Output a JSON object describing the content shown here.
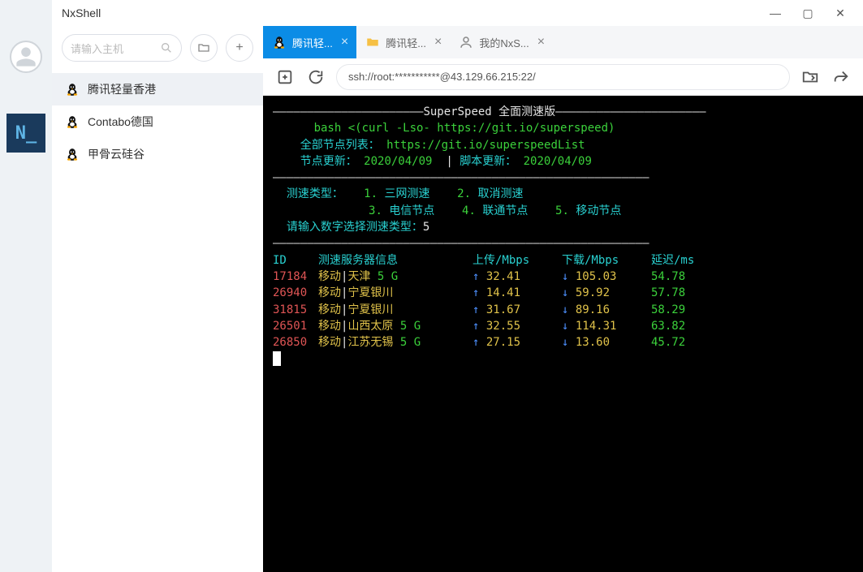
{
  "app": {
    "title": "NxShell",
    "icon_text": "N_"
  },
  "window": {
    "min": "—",
    "max": "▢",
    "close": "✕"
  },
  "sidebar": {
    "search_placeholder": "请输入主机",
    "hosts": [
      {
        "label": "腾讯轻量香港",
        "active": true
      },
      {
        "label": "Contabo德国",
        "active": false
      },
      {
        "label": "甲骨云硅谷",
        "active": false
      }
    ]
  },
  "tabs": [
    {
      "label": "腾讯轻...",
      "type": "terminal",
      "active": true
    },
    {
      "label": "腾讯轻...",
      "type": "folder",
      "active": false
    },
    {
      "label": "我的NxS...",
      "type": "user",
      "active": false
    }
  ],
  "address": {
    "url": "ssh://root:***********@43.129.66.215:22/"
  },
  "terminal": {
    "banner_title": "SuperSpeed 全面测速版",
    "banner_cmd": "bash <(curl -Lso- https://git.io/superspeed)",
    "list_label": "全部节点列表： ",
    "list_url": "https://git.io/superspeedList",
    "update_node_label": "节点更新：",
    "update_node_date": "2020/04/09",
    "update_script_label": "脚本更新：",
    "update_script_date": "2020/04/09",
    "type_label": "测速类型：",
    "options": [
      {
        "n": "1.",
        "t": "三网测速"
      },
      {
        "n": "2.",
        "t": "取消测速"
      },
      {
        "n": "3.",
        "t": "电信节点"
      },
      {
        "n": "4.",
        "t": "联通节点"
      },
      {
        "n": "5.",
        "t": "移动节点"
      }
    ],
    "prompt_label": "请输入数字选择测速类型：",
    "prompt_value": "5",
    "headers": {
      "id": "ID",
      "info": "测速服务器信息",
      "up": "上传/Mbps",
      "down": "下载/Mbps",
      "lat": "延迟/ms"
    },
    "rows": [
      {
        "id": "17184",
        "carrier": "移动",
        "city": "天津",
        "net": "5 G",
        "up": "32.41",
        "down": "105.03",
        "lat": "54.78"
      },
      {
        "id": "26940",
        "carrier": "移动",
        "city": "宁夏银川",
        "net": "",
        "up": "14.41",
        "down": "59.92",
        "lat": "57.78"
      },
      {
        "id": "31815",
        "carrier": "移动",
        "city": "宁夏银川",
        "net": "",
        "up": "31.67",
        "down": "89.16",
        "lat": "58.29"
      },
      {
        "id": "26501",
        "carrier": "移动",
        "city": "山西太原",
        "net": "5 G",
        "up": "32.55",
        "down": "114.31",
        "lat": "63.82"
      },
      {
        "id": "26850",
        "carrier": "移动",
        "city": "江苏无锡",
        "net": "5 G",
        "up": "27.15",
        "down": "13.60",
        "lat": "45.72"
      }
    ]
  }
}
